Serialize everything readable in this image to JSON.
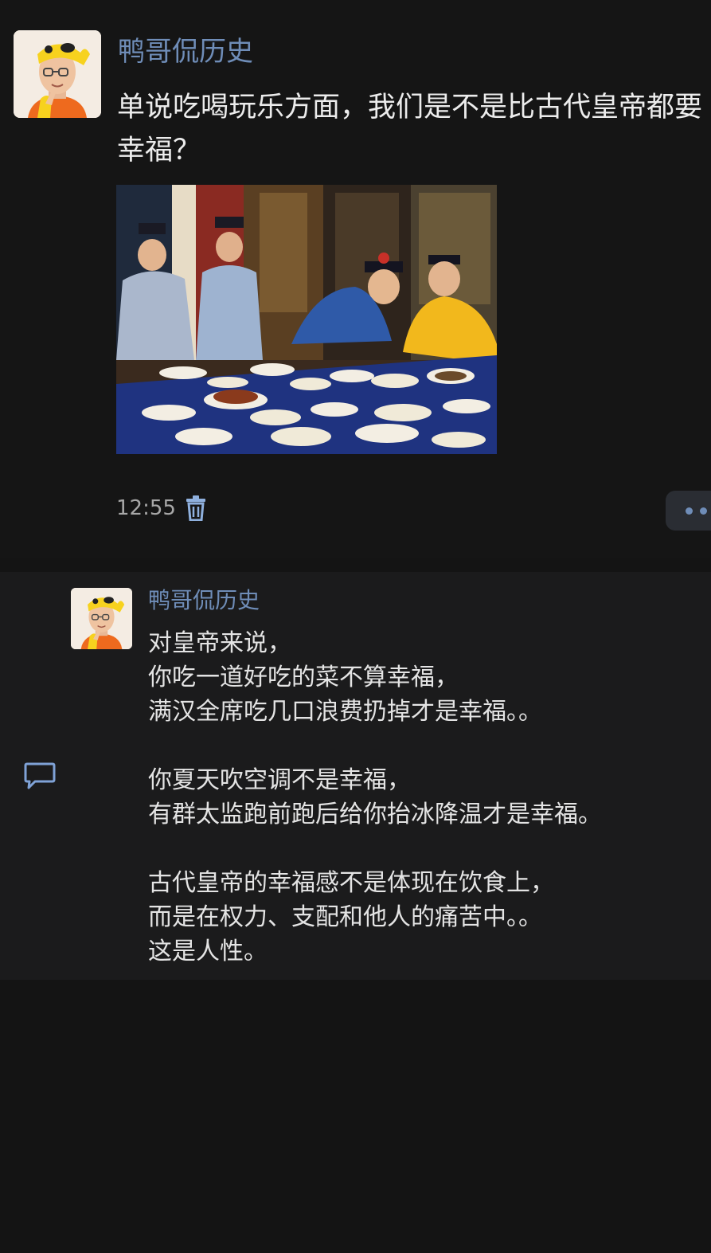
{
  "post": {
    "author": "鸭哥侃历史",
    "text": "单说吃喝玩乐方面，我们是不是比古代皇帝都要幸福？",
    "image_icon": "banquet-photo",
    "timestamp": "12:55",
    "delete_icon": "trash-icon",
    "more_icon": "more-dots-icon"
  },
  "comment": {
    "author": "鸭哥侃历史",
    "reply_icon": "comment-bubble-icon",
    "lines": [
      "对皇帝来说，",
      "你吃一道好吃的菜不算幸福，",
      "满汉全席吃几口浪费扔掉才是幸福。。",
      "",
      "你夏天吹空调不是幸福，",
      "有群太监跑前跑后给你抬冰降温才是幸福。",
      "",
      "古代皇帝的幸福感不是体现在饮食上，",
      "而是在权力、支配和他人的痛苦中。。",
      "这是人性。"
    ]
  },
  "colors": {
    "background": "#141414",
    "comment_background": "#1b1b1c",
    "author_name": "#6f8db8",
    "accent_icon": "#8fb0de",
    "text": "#ececec",
    "meta_text": "#a8a8a8"
  }
}
